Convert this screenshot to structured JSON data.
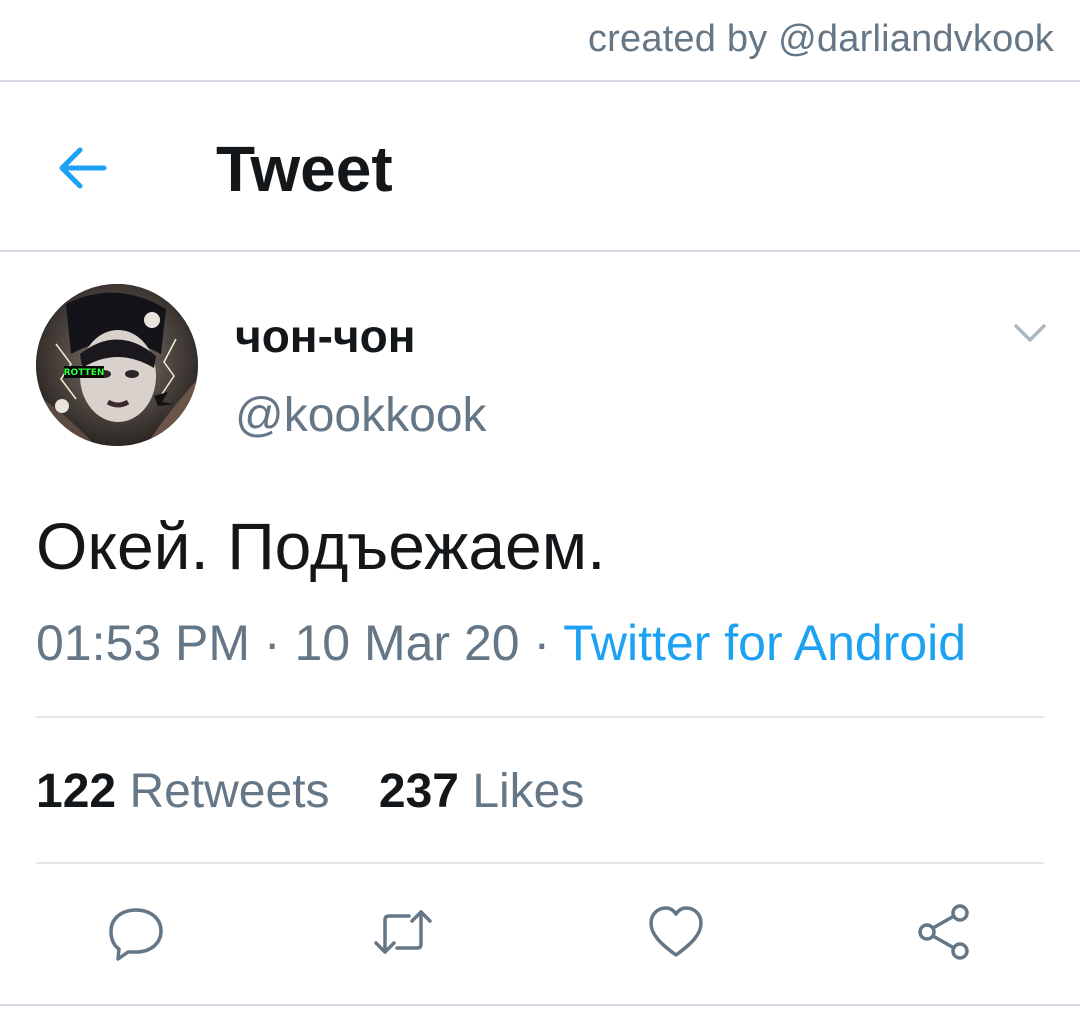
{
  "watermark": {
    "credit": "created by @darliandvkook"
  },
  "header": {
    "title": "Tweet",
    "back_icon": "arrow-left-icon"
  },
  "tweet": {
    "author": {
      "display_name": "чон-чон",
      "handle": "@kookkook",
      "avatar_badge": "ROTTEN"
    },
    "text": "Окей. Подъежаем.",
    "time": "01:53 PM",
    "separator": " · ",
    "date": "10 Mar 20",
    "source": "Twitter for Android"
  },
  "stats": {
    "retweets_count": "122",
    "retweets_label": "Retweets",
    "likes_count": "237",
    "likes_label": "Likes"
  },
  "actions": [
    "reply-icon",
    "retweet-icon",
    "like-icon",
    "share-icon"
  ],
  "colors": {
    "accent": "#1da1f2",
    "text_primary": "#14171a",
    "text_secondary": "#657786",
    "divider": "#e1e8ed"
  }
}
